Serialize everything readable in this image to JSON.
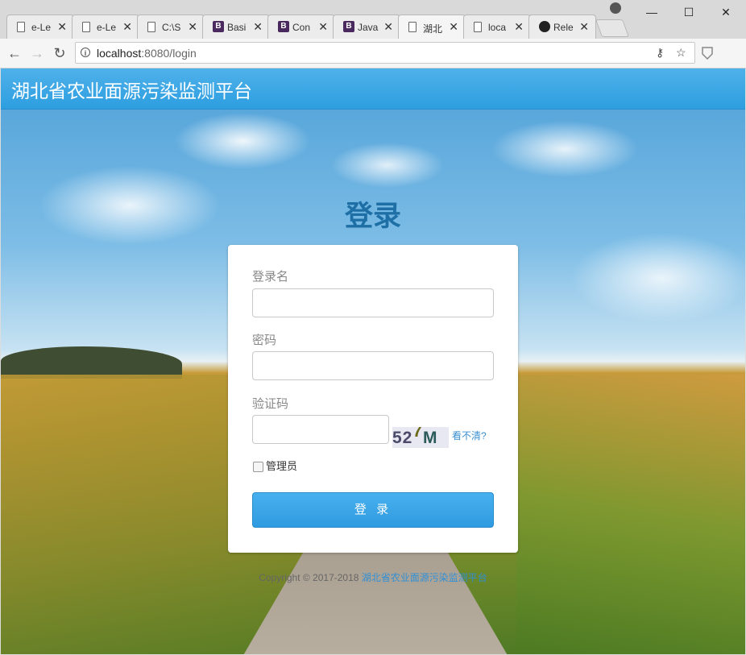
{
  "browser": {
    "tabs": [
      {
        "title": "e-Le",
        "icon": "doc-icon",
        "active": false
      },
      {
        "title": "e-Le",
        "icon": "doc-icon",
        "active": false
      },
      {
        "title": "C:\\S",
        "icon": "doc-icon",
        "active": false
      },
      {
        "title": "Basi",
        "icon": "bootstrap-icon",
        "active": false
      },
      {
        "title": "Con",
        "icon": "bootstrap-icon",
        "active": false
      },
      {
        "title": "Java",
        "icon": "bootstrap-icon",
        "active": false
      },
      {
        "title": "湖北",
        "icon": "doc-icon",
        "active": true
      },
      {
        "title": "loca",
        "icon": "doc-icon",
        "active": false
      },
      {
        "title": "Rele",
        "icon": "github-icon",
        "active": false
      }
    ],
    "close_glyph": "✕",
    "url_host": "localhost",
    "url_path": ":8080/login",
    "window_controls": {
      "minimize": "—",
      "maximize": "☐",
      "close": "✕"
    }
  },
  "header": {
    "brand": "湖北省农业面源污染监测平台"
  },
  "login": {
    "title": "登录",
    "username_label": "登录名",
    "password_label": "密码",
    "captcha_label": "验证码",
    "captcha_chars": {
      "a": "52",
      "b": "7",
      "c": "M"
    },
    "refresh_label": "看不清?",
    "admin_label": "管理员",
    "submit_label": "登 录"
  },
  "footer": {
    "copyright": "Copyright © 2017-2018 ",
    "link": "湖北省农业面源污染监测平台"
  },
  "colors": {
    "header": "#2d9ee0",
    "title": "#1d6fa5",
    "button": "#3aa6e8"
  }
}
